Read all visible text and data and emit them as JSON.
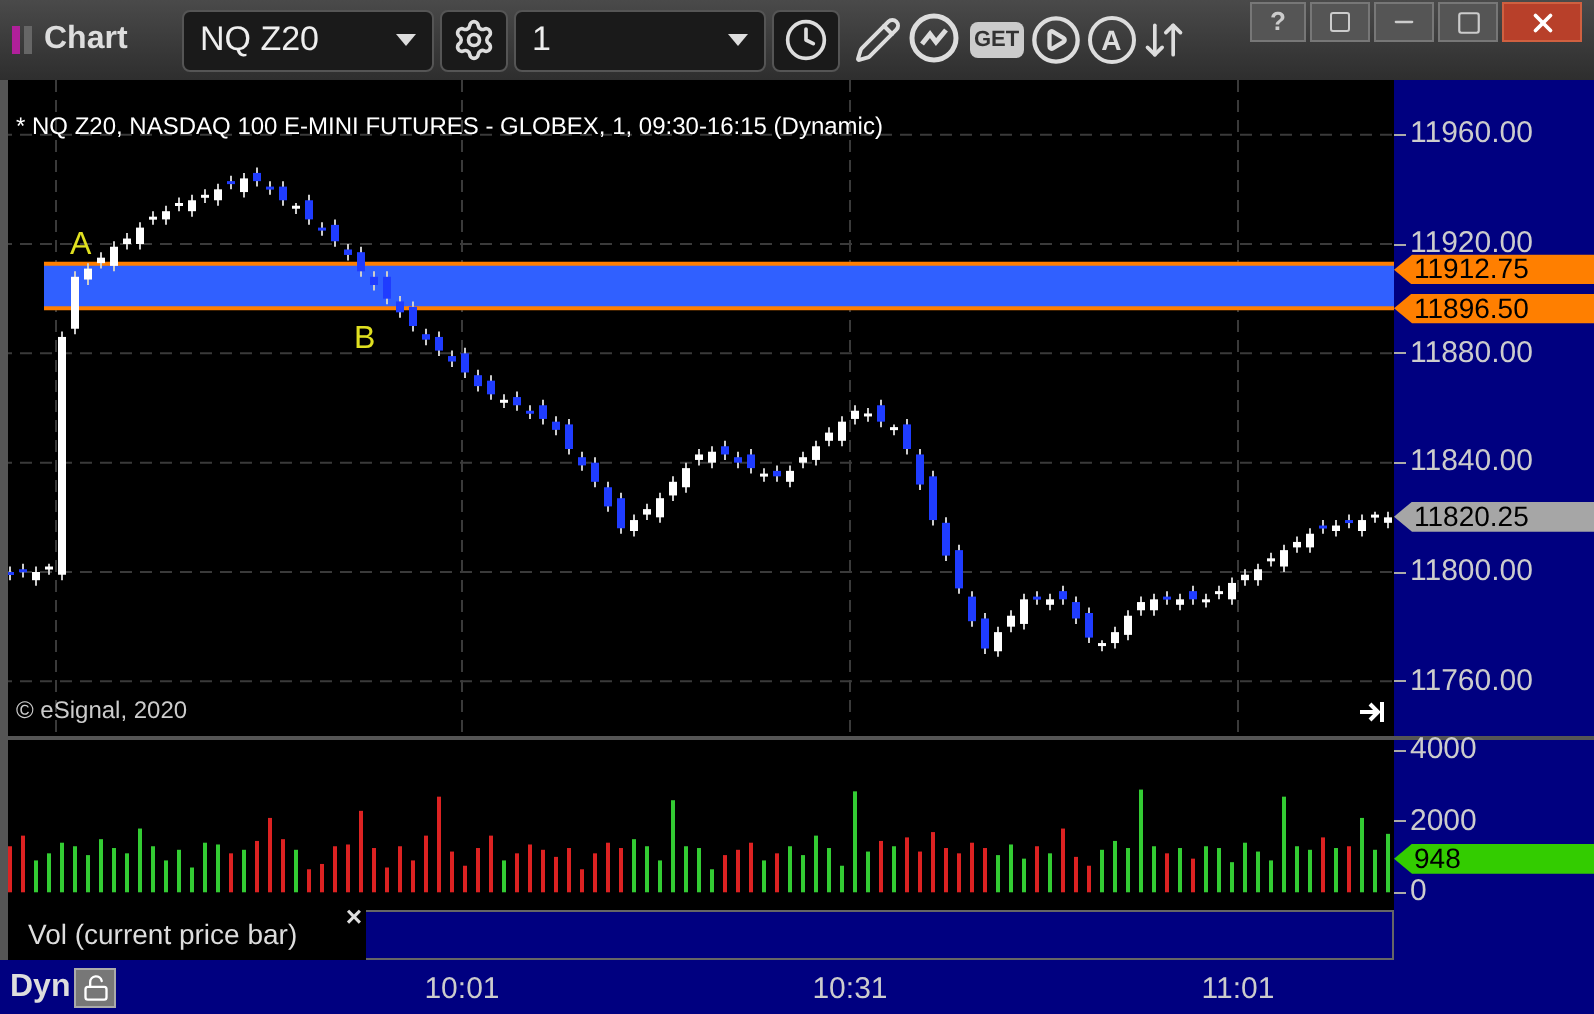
{
  "window": {
    "title": "Chart",
    "help": "?"
  },
  "toolbar": {
    "symbol": "NQ Z20",
    "interval": "1",
    "get_label": "GET",
    "alert_label": "A"
  },
  "chart": {
    "legend": "* NQ Z20, NASDAQ 100 E-MINI FUTURES - GLOBEX, 1, 09:30-16:15 (Dynamic)",
    "copyright": "© eSignal, 2020",
    "price_tags": [
      {
        "text": "11912.75",
        "color": "#ff7f00"
      },
      {
        "text": "11896.50",
        "color": "#ff7f00"
      },
      {
        "text": "11820.25",
        "color": "#a6a6a6"
      }
    ],
    "zone_labels": [
      "A",
      "B"
    ],
    "chart_data": {
      "type": "candlestick",
      "yticks": [
        {
          "value": 11960,
          "label": "11960.00"
        },
        {
          "value": 11920,
          "label": "11920.00"
        },
        {
          "value": 11880,
          "label": "11880.00"
        },
        {
          "value": 11840,
          "label": "11840.00"
        },
        {
          "value": 11800,
          "label": "11800.00"
        },
        {
          "value": 11760,
          "label": "11760.00"
        }
      ],
      "ylim": [
        11740,
        11980
      ],
      "grid": true,
      "bands": [
        {
          "axis": "y",
          "from": 11896.5,
          "to": 11912.75,
          "color": "#3060ff"
        }
      ],
      "ref_lines": [
        {
          "axis": "y",
          "value": 11912.75,
          "color": "#ff7f00"
        },
        {
          "axis": "y",
          "value": 11896.5,
          "color": "#ff7f00"
        }
      ],
      "categories": [
        null,
        null,
        null,
        null,
        null,
        null,
        null,
        null,
        null,
        null,
        null,
        null,
        null,
        null,
        null,
        null,
        null,
        null,
        null,
        null,
        null,
        null,
        null,
        null,
        null,
        null,
        null,
        null,
        null,
        null,
        null,
        null,
        null,
        null,
        null,
        null,
        null,
        null,
        null,
        null,
        null,
        null,
        null,
        null,
        null,
        null,
        null,
        null,
        null,
        null,
        null,
        null,
        null,
        null,
        null,
        null,
        null,
        null,
        null,
        null,
        null,
        null,
        null,
        null,
        null,
        null,
        null,
        null,
        null,
        null,
        null,
        null,
        null,
        null,
        null,
        null,
        null,
        null,
        null,
        null,
        null,
        null,
        null,
        null,
        null,
        null,
        null,
        null,
        null,
        null,
        null,
        null,
        null,
        null,
        null,
        null,
        null,
        null,
        null,
        null,
        null,
        null,
        null,
        null,
        null,
        null,
        null
      ],
      "ohlc": [
        [
          11800,
          11802,
          11797,
          11799
        ],
        [
          11801,
          11803,
          11798,
          11800
        ],
        [
          11797,
          11802,
          11795,
          11800
        ],
        [
          11801,
          11803,
          11799,
          11802
        ],
        [
          11799,
          11888,
          11797,
          11886
        ],
        [
          11889,
          11910,
          11887,
          11908
        ],
        [
          11907,
          11913,
          11905,
          11911
        ],
        [
          11913,
          11917,
          11911,
          11915
        ],
        [
          11912,
          11921,
          11910,
          11919
        ],
        [
          11920,
          11924,
          11918,
          11922
        ],
        [
          11920,
          11928,
          11918,
          11926
        ],
        [
          11929,
          11932,
          11927,
          11930
        ],
        [
          11929,
          11934,
          11927,
          11932
        ],
        [
          11934,
          11937,
          11932,
          11935
        ],
        [
          11932,
          11938,
          11930,
          11936
        ],
        [
          11937,
          11940,
          11935,
          11938
        ],
        [
          11936,
          11942,
          11934,
          11940
        ],
        [
          11943,
          11945,
          11940,
          11942
        ],
        [
          11939,
          11946,
          11937,
          11944
        ],
        [
          11946,
          11948,
          11941,
          11943
        ],
        [
          11941,
          11943,
          11938,
          11940
        ],
        [
          11941,
          11943,
          11934,
          11936
        ],
        [
          11933,
          11935,
          11931,
          11934
        ],
        [
          11936,
          11938,
          11927,
          11929
        ],
        [
          11926,
          11928,
          11923,
          11925
        ],
        [
          11927,
          11929,
          11919,
          11921
        ],
        [
          11918,
          11920,
          11914,
          11916
        ],
        [
          11917,
          11919,
          11908,
          11910
        ],
        [
          11908,
          11910,
          11903,
          11905
        ],
        [
          11908,
          11910,
          11898,
          11900
        ],
        [
          11899,
          11901,
          11893,
          11895
        ],
        [
          11897,
          11899,
          11888,
          11890
        ],
        [
          11887,
          11889,
          11883,
          11885
        ],
        [
          11886,
          11888,
          11879,
          11881
        ],
        [
          11879,
          11881,
          11875,
          11877
        ],
        [
          11880,
          11882,
          11871,
          11873
        ],
        [
          11872,
          11874,
          11866,
          11868
        ],
        [
          11870,
          11872,
          11863,
          11865
        ],
        [
          11862,
          11865,
          11860,
          11863
        ],
        [
          11864,
          11866,
          11859,
          11861
        ],
        [
          11859,
          11861,
          11856,
          11858
        ],
        [
          11861,
          11863,
          11854,
          11856
        ],
        [
          11855,
          11857,
          11850,
          11852
        ],
        [
          11854,
          11856,
          11843,
          11845
        ],
        [
          11842,
          11844,
          11837,
          11839
        ],
        [
          11840,
          11842,
          11831,
          11833
        ],
        [
          11831,
          11833,
          11822,
          11824
        ],
        [
          11827,
          11829,
          11814,
          11816
        ],
        [
          11815,
          11821,
          11813,
          11819
        ],
        [
          11821,
          11825,
          11819,
          11823
        ],
        [
          11820,
          11829,
          11818,
          11827
        ],
        [
          11828,
          11835,
          11826,
          11833
        ],
        [
          11831,
          11840,
          11829,
          11838
        ],
        [
          11841,
          11845,
          11839,
          11843
        ],
        [
          11840,
          11846,
          11838,
          11844
        ],
        [
          11846,
          11848,
          11841,
          11843
        ],
        [
          11842,
          11844,
          11838,
          11840
        ],
        [
          11843,
          11845,
          11836,
          11838
        ],
        [
          11835,
          11838,
          11833,
          11836
        ],
        [
          11837,
          11839,
          11833,
          11835
        ],
        [
          11833,
          11839,
          11831,
          11837
        ],
        [
          11840,
          11844,
          11838,
          11842
        ],
        [
          11841,
          11848,
          11839,
          11846
        ],
        [
          11848,
          11853,
          11846,
          11851
        ],
        [
          11848,
          11857,
          11846,
          11855
        ],
        [
          11856,
          11861,
          11854,
          11859
        ],
        [
          11857,
          11860,
          11855,
          11858
        ],
        [
          11861,
          11863,
          11853,
          11855
        ],
        [
          11852,
          11854,
          11850,
          11853
        ],
        [
          11854,
          11856,
          11843,
          11845
        ],
        [
          11843,
          11845,
          11830,
          11832
        ],
        [
          11835,
          11837,
          11817,
          11819
        ],
        [
          11818,
          11820,
          11804,
          11806
        ],
        [
          11808,
          11810,
          11792,
          11794
        ],
        [
          11791,
          11793,
          11780,
          11782
        ],
        [
          11783,
          11785,
          11770,
          11772
        ],
        [
          11771,
          11780,
          11769,
          11778
        ],
        [
          11780,
          11786,
          11778,
          11784
        ],
        [
          11781,
          11792,
          11779,
          11790
        ],
        [
          11791,
          11793,
          11788,
          11790
        ],
        [
          11788,
          11792,
          11786,
          11790
        ],
        [
          11793,
          11795,
          11788,
          11790
        ],
        [
          11789,
          11791,
          11781,
          11783
        ],
        [
          11785,
          11787,
          11774,
          11776
        ],
        [
          11773,
          11775,
          11771,
          11774
        ],
        [
          11774,
          11780,
          11772,
          11778
        ],
        [
          11777,
          11786,
          11775,
          11784
        ],
        [
          11786,
          11791,
          11784,
          11789
        ],
        [
          11786,
          11792,
          11784,
          11790
        ],
        [
          11791,
          11793,
          11788,
          11790
        ],
        [
          11788,
          11792,
          11786,
          11790
        ],
        [
          11793,
          11795,
          11788,
          11790
        ],
        [
          11789,
          11792,
          11787,
          11790
        ],
        [
          11792,
          11795,
          11790,
          11793
        ],
        [
          11790,
          11798,
          11788,
          11796
        ],
        [
          11797,
          11801,
          11795,
          11799
        ],
        [
          11797,
          11803,
          11795,
          11801
        ],
        [
          11804,
          11807,
          11802,
          11805
        ],
        [
          11802,
          11810,
          11800,
          11808
        ],
        [
          11809,
          11813,
          11807,
          11811
        ],
        [
          11809,
          11816,
          11807,
          11814
        ],
        [
          11817,
          11819,
          11814,
          11816
        ],
        [
          11815,
          11819,
          11813,
          11817
        ],
        [
          11819,
          11821,
          11816,
          11818
        ],
        [
          11815,
          11821,
          11813,
          11819
        ],
        [
          11820,
          11822,
          11818,
          11821
        ],
        [
          11818,
          11822,
          11816,
          11820
        ]
      ]
    }
  },
  "volume": {
    "tag": {
      "text": "948",
      "color": "#33cc00"
    },
    "study_label": "Vol (current price bar)",
    "close": "×",
    "chart_data": {
      "type": "bar",
      "ylim": [
        -500,
        4300
      ],
      "yticks": [
        {
          "value": 4000,
          "label": "4000"
        },
        {
          "value": 2000,
          "label": "2000"
        },
        {
          "value": 0,
          "label": "0"
        }
      ],
      "categories": [
        null,
        null,
        null,
        null,
        null,
        null,
        null,
        null,
        null,
        null,
        null,
        null,
        null,
        null,
        null,
        null,
        null,
        null,
        null,
        null,
        null,
        null,
        null,
        null,
        null,
        null,
        null,
        null,
        null,
        null,
        null,
        null,
        null,
        null,
        null,
        null,
        null,
        null,
        null,
        null,
        null,
        null,
        null,
        null,
        null,
        null,
        null,
        null,
        null,
        null,
        null,
        null,
        null,
        null,
        null,
        null,
        null,
        null,
        null,
        null,
        null,
        null,
        null,
        null,
        null,
        null,
        null,
        null,
        null,
        null,
        null,
        null,
        null,
        null,
        null,
        null,
        null,
        null,
        null,
        null,
        null,
        null,
        null,
        null,
        null,
        null,
        null,
        null,
        null,
        null,
        null,
        null,
        null,
        null,
        null,
        null,
        null,
        null,
        null,
        null,
        null,
        null,
        null,
        null,
        null,
        null,
        null
      ],
      "values": [
        1300,
        1600,
        900,
        1100,
        1400,
        1300,
        1050,
        1500,
        1250,
        1100,
        1800,
        1300,
        900,
        1200,
        700,
        1400,
        1350,
        1100,
        1200,
        1450,
        2100,
        1500,
        1200,
        650,
        800,
        1300,
        1350,
        2300,
        1250,
        700,
        1300,
        900,
        1600,
        2700,
        1150,
        750,
        1250,
        1600,
        900,
        1100,
        1350,
        1200,
        1000,
        1250,
        650,
        1100,
        1400,
        1250,
        1500,
        1300,
        900,
        2600,
        1300,
        1250,
        650,
        1050,
        1200,
        1400,
        900,
        1100,
        1300,
        1050,
        1600,
        1250,
        750,
        2850,
        1150,
        1450,
        1300,
        1550,
        1150,
        1700,
        1250,
        1100,
        1400,
        1250,
        1050,
        1350,
        950,
        1300,
        1100,
        1800,
        1000,
        750,
        1200,
        1450,
        1250,
        2900,
        1300,
        1100,
        1250,
        950,
        1300,
        1250,
        850,
        1400,
        1150,
        900,
        2700,
        1300,
        1200,
        1550,
        1250,
        1300,
        2100,
        1200,
        1650
      ]
    }
  },
  "time_axis": {
    "mode": "Dyn",
    "times": [
      "10:01",
      "10:31",
      "11:01"
    ]
  }
}
